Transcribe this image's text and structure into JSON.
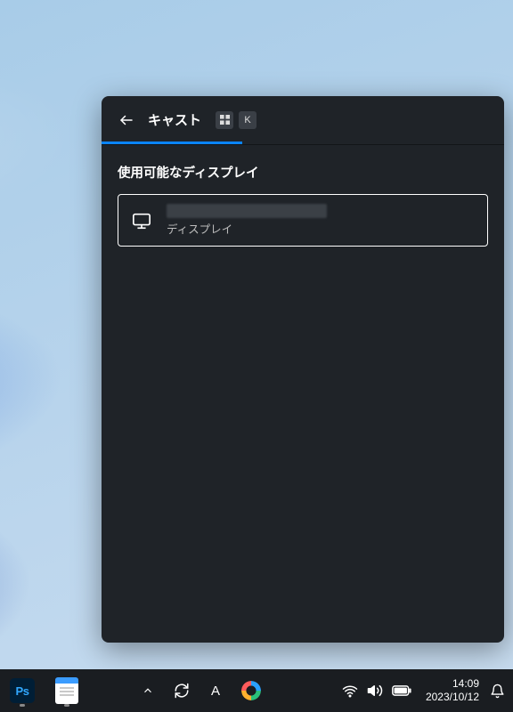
{
  "cast": {
    "title": "キャスト",
    "shortcut_keys": [
      "Win",
      "K"
    ],
    "section_label": "使用可能なディスプレイ",
    "displays": [
      {
        "name_hidden": true,
        "subtitle": "ディスプレイ"
      }
    ]
  },
  "taskbar": {
    "apps": {
      "photoshop_label": "Ps",
      "notepad_name": "notepad"
    },
    "ime_letter": "A",
    "clock": {
      "time": "14:09",
      "date": "2023/10/12"
    }
  },
  "colors": {
    "panel_bg": "#1f2328",
    "accent": "#0a84ff",
    "taskbar_bg": "#1a1d21"
  }
}
